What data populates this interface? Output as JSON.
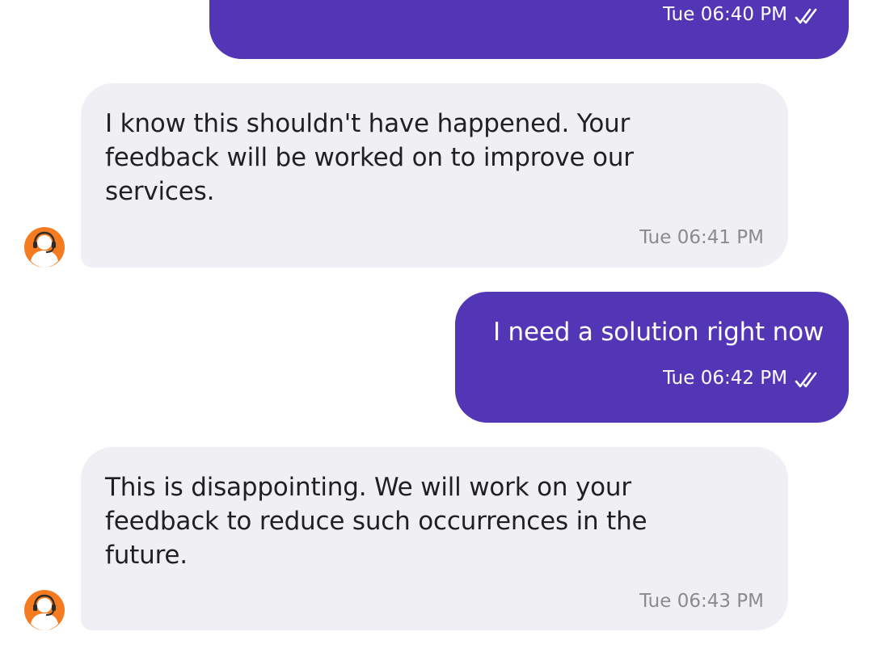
{
  "colors": {
    "sent_bubble": "#5236b6",
    "received_bubble": "#f0eff4",
    "agent_avatar": "#f47b20"
  },
  "messages": [
    {
      "direction": "sent",
      "text": "",
      "time": "Tue 06:40 PM",
      "status_icon": "double-check-icon"
    },
    {
      "direction": "received",
      "lines": [
        "I know this shouldn't have happened. Your",
        "feedback will be worked on to improve our",
        "services."
      ],
      "time": "Tue 06:41 PM",
      "avatar_icon": "agent-headset-icon"
    },
    {
      "direction": "sent",
      "text": "I need a solution right now",
      "time": "Tue 06:42 PM",
      "status_icon": "double-check-icon"
    },
    {
      "direction": "received",
      "lines": [
        "This is disappointing. We will work on your",
        "feedback to reduce such occurrences in the",
        "future."
      ],
      "time": "Tue 06:43 PM",
      "avatar_icon": "agent-headset-icon"
    }
  ]
}
